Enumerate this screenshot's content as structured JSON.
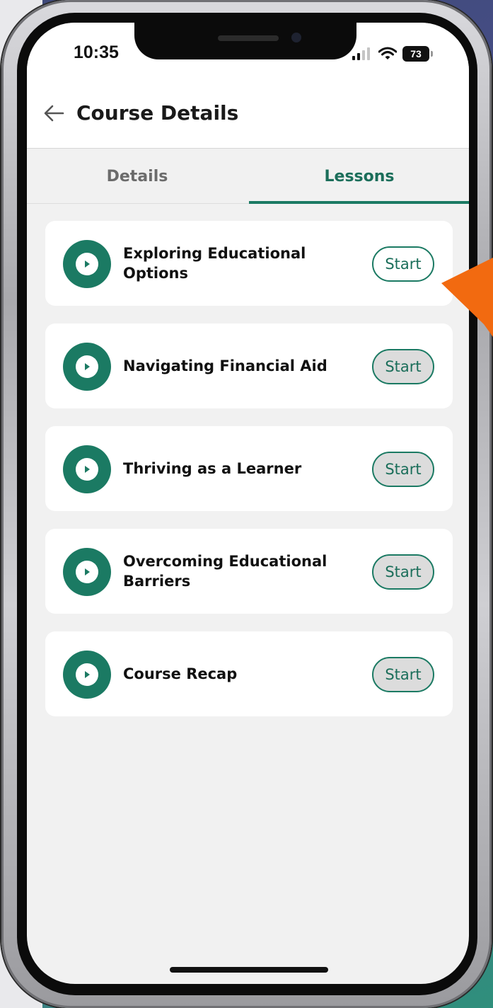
{
  "status_bar": {
    "time": "10:35",
    "battery": "73",
    "icons": [
      "cellular-signal-icon",
      "wifi-icon",
      "battery-icon"
    ]
  },
  "header": {
    "back_icon": "arrow-left-icon",
    "title": "Course Details"
  },
  "tabs": [
    {
      "label": "Details",
      "selected": false
    },
    {
      "label": "Lessons",
      "selected": true
    }
  ],
  "lessons": [
    {
      "title": "Exploring Educational Options",
      "button": "Start",
      "icon": "play-icon"
    },
    {
      "title": "Navigating Financial Aid",
      "button": "Start",
      "icon": "play-icon"
    },
    {
      "title": "Thriving as a Learner",
      "button": "Start",
      "icon": "play-icon"
    },
    {
      "title": "Overcoming Educational Barriers",
      "button": "Start",
      "icon": "play-icon"
    },
    {
      "title": "Course Recap",
      "button": "Start",
      "icon": "play-icon"
    }
  ],
  "colors": {
    "accent": "#1b7a63",
    "screen_background": "#f1f1f1",
    "card_background": "#ffffff",
    "pointer_arrow": "#f26a10"
  }
}
